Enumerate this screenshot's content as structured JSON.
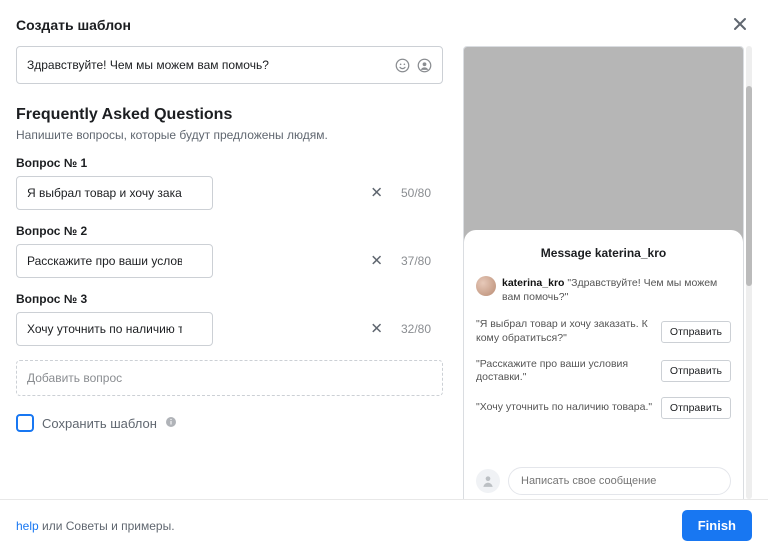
{
  "header": {
    "title": "Создать шаблон"
  },
  "greeting": {
    "text": "Здравствуйте! Чем мы можем вам помочь?"
  },
  "faq": {
    "heading": "Frequently Asked Questions",
    "subheading": "Напишите вопросы, которые будут предложены людям.",
    "questions": [
      {
        "label": "Вопрос № 1",
        "value": "Я выбрал товар и хочу заказать. К кому обратиться?",
        "counter": "50/80"
      },
      {
        "label": "Вопрос № 2",
        "value": "Расскажите про ваши условия доставки.",
        "counter": "37/80"
      },
      {
        "label": "Вопрос № 3",
        "value": "Хочу уточнить по наличию товара.",
        "counter": "32/80"
      }
    ],
    "add_label": "Добавить вопрос"
  },
  "save_template": {
    "label": "Сохранить шаблон"
  },
  "preview": {
    "title_prefix": "Message",
    "username": "katerina_kro",
    "greeting_user": "katerina_kro",
    "greeting_text": "\"Здравствуйте! Чем мы можем вам помочь?\"",
    "rows": [
      {
        "text": "\"Я выбрал товар и хочу заказать. К кому обратиться?\"",
        "send": "Отправить"
      },
      {
        "text": "\"Расскажите про ваши условия доставки.\"",
        "send": "Отправить"
      },
      {
        "text": "\"Хочу уточнить по наличию товара.\"",
        "send": "Отправить"
      }
    ],
    "msg_placeholder": "Написать свое сообщение"
  },
  "footer": {
    "help_link": "help",
    "help_rest": " или Советы и примеры.",
    "finish": "Finish"
  }
}
